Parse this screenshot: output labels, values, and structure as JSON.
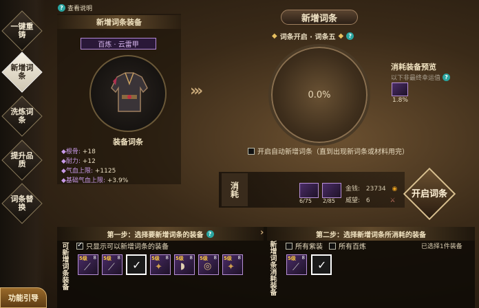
{
  "help_link": "查看说明",
  "menu": [
    {
      "label": "一键重铸",
      "active": false
    },
    {
      "label": "新增词条",
      "active": true
    },
    {
      "label": "洗炼词条",
      "active": false
    },
    {
      "label": "提升品质",
      "active": false
    },
    {
      "label": "词条替换",
      "active": false
    }
  ],
  "function_guide": "功能引导",
  "left_panel": {
    "header": "新增词条装备",
    "equip_name": "百炼 · 云雷甲",
    "attr_title": "装备词条",
    "stats": [
      {
        "name": "根骨",
        "value": "+18"
      },
      {
        "name": "耐力",
        "value": "+12"
      },
      {
        "name": "气血上限",
        "value": "+1125"
      },
      {
        "name": "基础气血上限",
        "value": "+3.9%"
      }
    ]
  },
  "center": {
    "title": "新增词条",
    "subtitle": "词条开启 · 词条五",
    "progress": "0.0%",
    "auto_checkbox_label": "开启自动新增词条（直到出现新词条或材料用完）",
    "auto_checked": false
  },
  "preview": {
    "title": "消耗装备预览",
    "note": "以下非最终幸运值",
    "rate": "1.8%"
  },
  "consume": {
    "label": "消耗",
    "items": [
      {
        "count": "6/75"
      },
      {
        "count": "2/85"
      }
    ],
    "money_label": "金钱:",
    "money_value": "23734",
    "prestige_label": "威望:",
    "prestige_value": "6",
    "open_button": "开启词条"
  },
  "step1": {
    "title": "第一步：选择要新增词条的装备",
    "side_label": "可新增词条装备",
    "filter_label": "只显示可以新增词条的装备",
    "filter_checked": true,
    "slots": [
      {
        "tag": "5级",
        "num": "8",
        "selected": false
      },
      {
        "tag": "5级",
        "num": "8",
        "selected": false
      },
      {
        "tag": "",
        "num": "",
        "selected": true
      },
      {
        "tag": "5级",
        "num": "8",
        "selected": false
      },
      {
        "tag": "5级",
        "num": "8",
        "selected": false
      },
      {
        "tag": "5级",
        "num": "8",
        "selected": false
      },
      {
        "tag": "5级",
        "num": "8",
        "selected": false
      }
    ]
  },
  "step2": {
    "title": "第二步：选择新增词条所消耗的装备",
    "side_label": "新增词条消耗装备",
    "filter_purple": "所有紫装",
    "filter_bailian": "所有百炼",
    "selected_count": "已选择1件装备",
    "slots": [
      {
        "tag": "5级",
        "num": "8",
        "selected": false
      },
      {
        "tag": "",
        "num": "",
        "selected": true
      }
    ]
  }
}
